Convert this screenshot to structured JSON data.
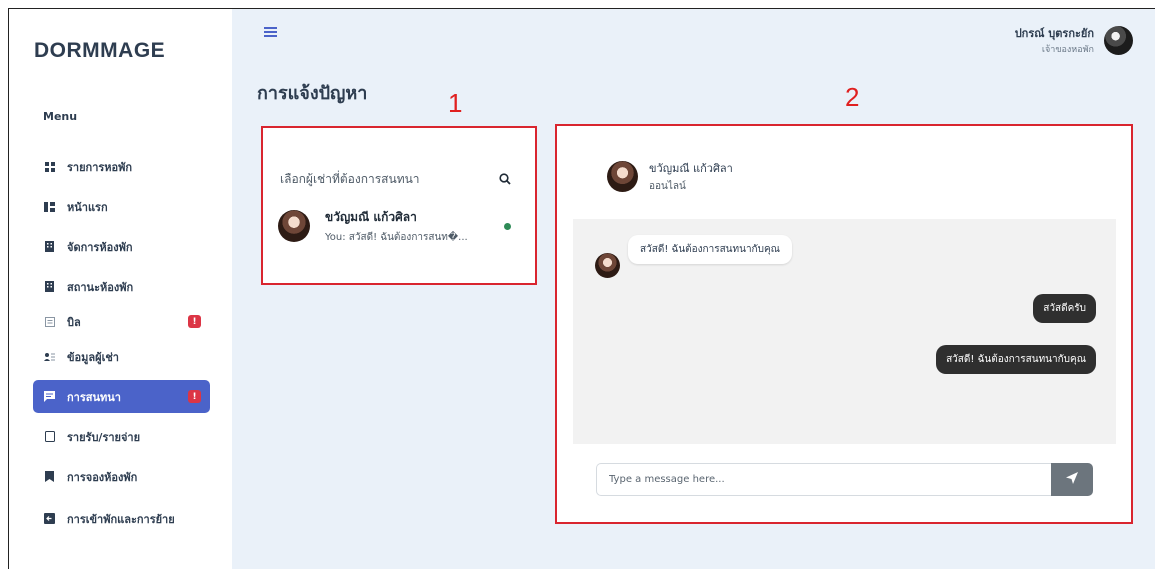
{
  "sidebar": {
    "brand": "DORMMAGE",
    "menu_title": "Menu",
    "items": [
      {
        "label": "รายการหอพัก",
        "icon": "grid-icon",
        "active": false,
        "badge": ""
      },
      {
        "label": "หน้าแรก",
        "icon": "dashboard-icon",
        "active": false,
        "badge": ""
      },
      {
        "label": "จัดการห้องพัก",
        "icon": "building-icon",
        "active": false,
        "badge": ""
      },
      {
        "label": "สถานะห้องพัก",
        "icon": "building-icon",
        "active": false,
        "badge": ""
      },
      {
        "label": "บิล",
        "icon": "receipt-icon",
        "active": false,
        "badge": "!"
      },
      {
        "label": "ข้อมูลผู้เช่า",
        "icon": "users-icon",
        "active": false,
        "badge": ""
      },
      {
        "label": "การสนทนา",
        "icon": "chat-icon",
        "active": true,
        "badge": "!"
      },
      {
        "label": "รายรับ/รายจ่าย",
        "icon": "wallet-icon",
        "active": false,
        "badge": ""
      },
      {
        "label": "การจองห้องพัก",
        "icon": "bookmark-icon",
        "active": false,
        "badge": ""
      },
      {
        "label": "การเข้าพักและการย้าย",
        "icon": "move-icon",
        "active": false,
        "badge": ""
      }
    ]
  },
  "header": {
    "user_name": "ปกรณ์ บุตรกะยัก",
    "user_role": "เจ้าของหอพัก"
  },
  "page": {
    "title": "การแจ้งปัญหา",
    "annotation_1": "1",
    "annotation_2": "2"
  },
  "contacts": {
    "search_placeholder": "เลือกผู้เช่าที่ต้องการสนทนา",
    "items": [
      {
        "name": "ขวัญมณี แก้วศิลา",
        "preview": "You: สวัสดี! ฉันต้องการสนท�...",
        "online": true
      }
    ]
  },
  "chat": {
    "partner_name": "ขวัญมณี แก้วศิลา",
    "partner_status": "ออนไลน์",
    "messages": [
      {
        "direction": "in",
        "text": "สวัสดี! ฉันต้องการสนทนากับคุณ"
      },
      {
        "direction": "out",
        "text": "สวัสดีครับ"
      },
      {
        "direction": "out",
        "text": "สวัสดี! ฉันต้องการสนทนากับคุณ"
      }
    ],
    "input_placeholder": "Type a message here..."
  },
  "colors": {
    "accent": "#4b63c9",
    "badge": "#dc3545",
    "annotation": "#d9252f",
    "online": "#2e8b57"
  }
}
